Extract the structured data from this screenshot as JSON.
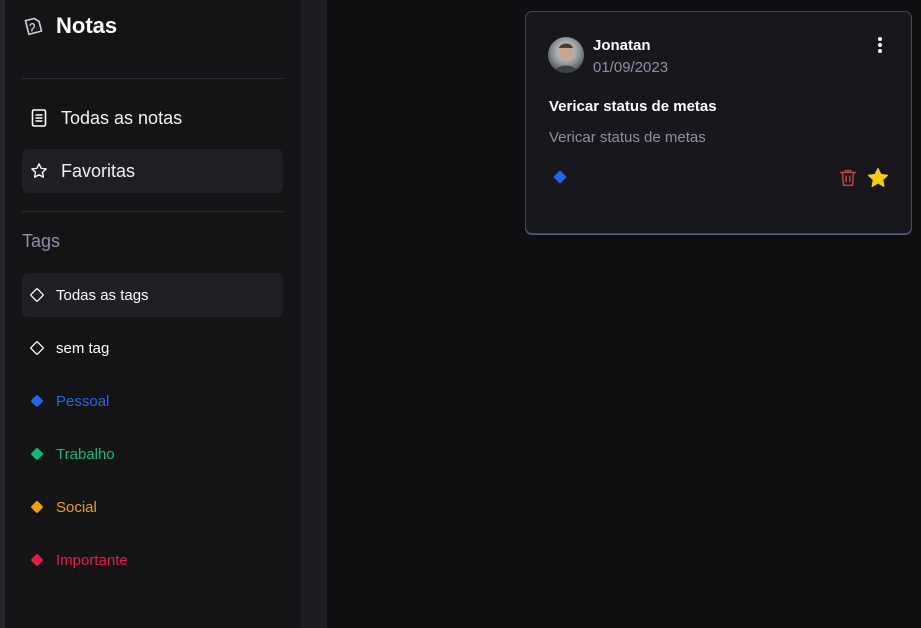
{
  "app": {
    "title": "Notas",
    "logo_icon": "notes-logo-icon"
  },
  "nav": {
    "items": [
      {
        "label": "Todas as notas",
        "icon": "document-icon",
        "active": false
      },
      {
        "label": "Favoritas",
        "icon": "star-outline-icon",
        "active": true
      }
    ]
  },
  "tags": {
    "heading": "Tags",
    "items": [
      {
        "label": "Todas as tags",
        "color": "#ffffff",
        "filled": false,
        "active": true
      },
      {
        "label": "sem tag",
        "color": "#ffffff",
        "filled": false,
        "active": false
      },
      {
        "label": "Pessoal",
        "color": "#2563eb",
        "filled": true,
        "active": false
      },
      {
        "label": "Trabalho",
        "color": "#10b981",
        "filled": true,
        "active": false
      },
      {
        "label": "Social",
        "color": "#f59e0b",
        "filled": true,
        "active": false
      },
      {
        "label": "Importante",
        "color": "#e11d48",
        "filled": true,
        "active": false
      }
    ]
  },
  "note": {
    "author": "Jonatan",
    "date": "01/09/2023",
    "title": "Vericar status de metas",
    "body": "Vericar status de metas",
    "tag_color": "#2563eb",
    "favorite": true,
    "icons": {
      "menu": "more-vertical-icon",
      "delete": "trash-icon",
      "favorite": "star-filled-icon"
    },
    "colors": {
      "trash": "#b4433e",
      "star": "#facc15"
    }
  }
}
